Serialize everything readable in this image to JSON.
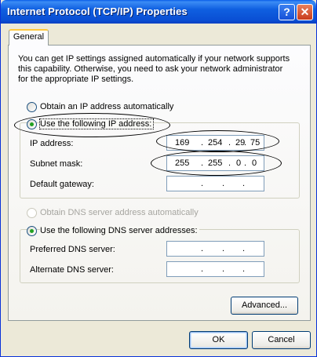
{
  "window": {
    "title": "Internet Protocol (TCP/IP) Properties",
    "help_glyph": "?",
    "close_glyph": "✕"
  },
  "tabs": [
    {
      "label": "General"
    }
  ],
  "description": "You can get IP settings assigned automatically if your network supports this capability. Otherwise, you need to ask your network administrator for the appropriate IP settings.",
  "ip_mode": {
    "auto_label": "Obtain an IP address automatically",
    "manual_label": "Use the following IP address:",
    "selected": "manual"
  },
  "ip_fields": [
    {
      "label": "IP address:",
      "octets": [
        "169",
        "254",
        "29",
        "75"
      ]
    },
    {
      "label": "Subnet mask:",
      "octets": [
        "255",
        "255",
        "0",
        "0"
      ]
    },
    {
      "label": "Default gateway:",
      "octets": [
        "",
        "",
        "",
        ""
      ]
    }
  ],
  "dns_mode": {
    "auto_label": "Obtain DNS server address automatically",
    "manual_label": "Use the following DNS server addresses:",
    "selected": "manual"
  },
  "dns_fields": [
    {
      "label": "Preferred DNS server:",
      "octets": [
        "",
        "",
        "",
        ""
      ]
    },
    {
      "label": "Alternate DNS server:",
      "octets": [
        "",
        "",
        "",
        ""
      ]
    }
  ],
  "octet_separator": ".",
  "buttons": {
    "advanced": "Advanced...",
    "ok": "OK",
    "cancel": "Cancel"
  },
  "colors": {
    "titlebar": "#0a5ee8",
    "dialog_bg": "#ece9d8",
    "radio_dot": "#21a121",
    "tab_accent": "#ffc83c"
  }
}
